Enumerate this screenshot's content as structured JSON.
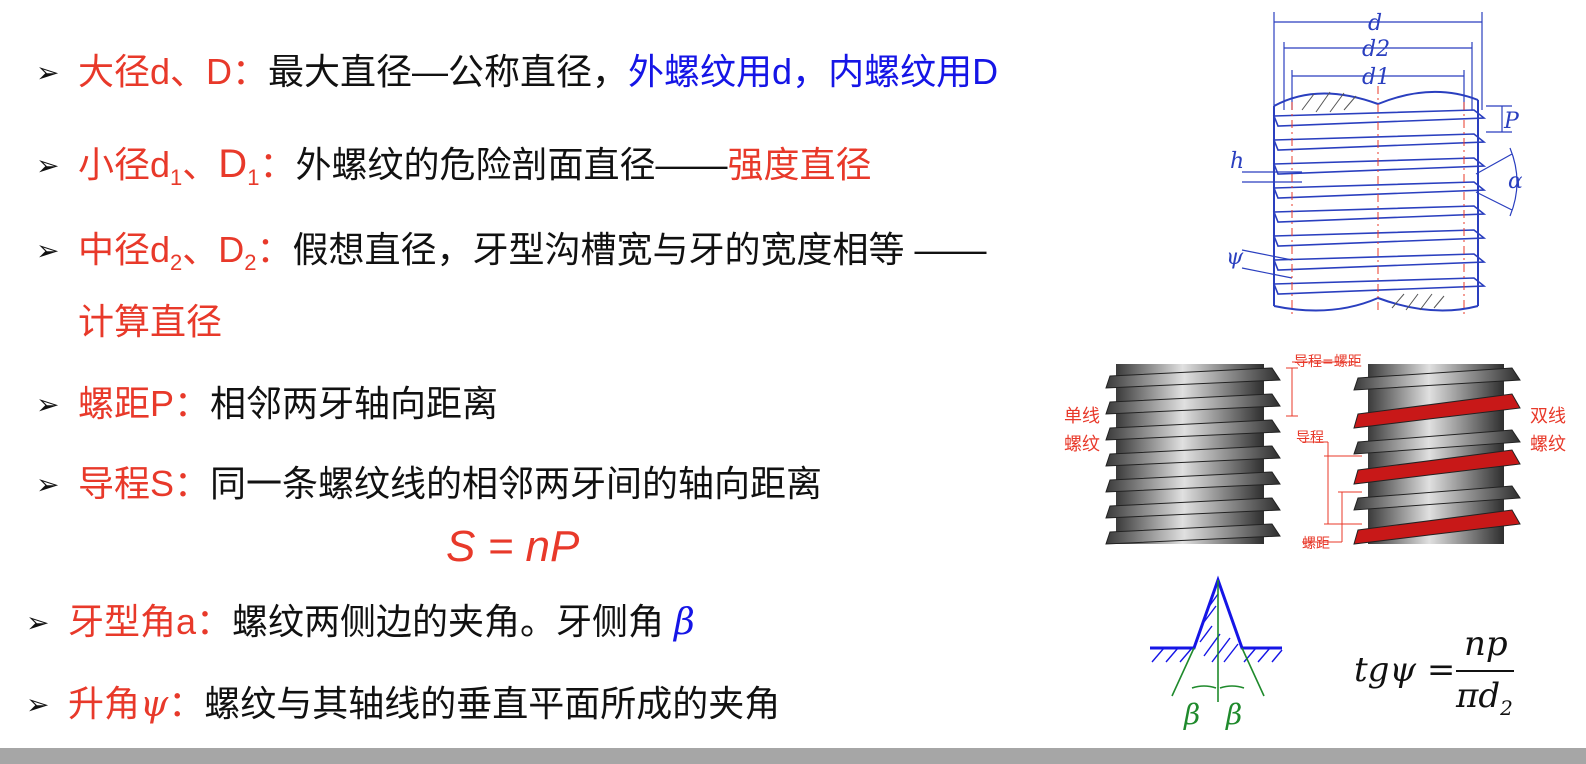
{
  "bullets": [
    {
      "term": "大径d、D：",
      "desc": "最大直径—公称直径，",
      "extra": "外螺纹用d，内螺纹用D"
    },
    {
      "term_a": "小径d",
      "term_sub1": "1",
      "term_b": "、",
      "term_c": "D",
      "term_sub2": "1",
      "term_d": "：",
      "desc": "外螺纹的危险剖面直径——",
      "emph": "强度直径"
    },
    {
      "term_a": "中径d",
      "term_sub1": "2",
      "term_b": "、D",
      "term_sub2": "2",
      "term_d": "：",
      "desc": "假想直径，牙型沟槽宽与牙的宽度相等 ——",
      "cont": "计算直径"
    },
    {
      "term": "螺距P：",
      "desc": "相邻两牙轴向距离"
    },
    {
      "term": "导程S：",
      "desc": "同一条螺纹线的相邻两牙间的轴向距离"
    },
    {
      "term": "牙型角a：",
      "desc": "螺纹两侧边的夹角。牙侧角 ",
      "symbol": "β"
    },
    {
      "term_a": "升角",
      "symbol": "ψ",
      "term_b": "：",
      "desc": "螺纹与其轴线的垂直平面所成的夹角"
    }
  ],
  "formula_sn": "S = nP",
  "thread_figure": {
    "d": "d",
    "d2": "d2",
    "d1": "d1",
    "p": "P",
    "h": "h",
    "alpha": "α",
    "psi": "ψ"
  },
  "lead_figure": {
    "left_l1": "单线",
    "left_l2": "螺纹",
    "right_l1": "双线",
    "right_l2": "螺纹",
    "lead_eq": "导程=螺距",
    "lead": "导程",
    "pitch": "螺距"
  },
  "angle_figure": {
    "beta_left": "β",
    "beta_right": "β"
  },
  "tan_formula": {
    "lhs": "tgψ =",
    "num": "np",
    "den_a": "πd",
    "den_sub": "2"
  },
  "colors": {
    "red": "#e8392a",
    "blue": "#1515e6",
    "line_blue": "#2a3fbf",
    "green": "#1f8a2c"
  }
}
